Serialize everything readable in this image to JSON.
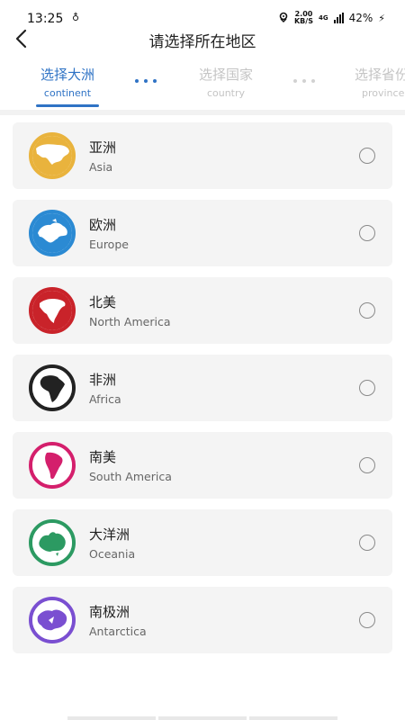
{
  "status": {
    "time": "13:25",
    "extra": "ᵍⁱ",
    "speed_top": "2.00",
    "speed_bottom": "KB/S",
    "network": "4G",
    "battery": "42%"
  },
  "header": {
    "title": "请选择所在地区"
  },
  "tabs": [
    {
      "zh": "选择大洲",
      "en": "continent"
    },
    {
      "zh": "选择国家",
      "en": "country"
    },
    {
      "zh": "选择省份",
      "en": "province"
    }
  ],
  "continents": [
    {
      "zh": "亚洲",
      "en": "Asia",
      "color": "#e9b33d",
      "icon": "asia-map-icon"
    },
    {
      "zh": "欧洲",
      "en": "Europe",
      "color": "#2b8ad3",
      "icon": "europe-map-icon"
    },
    {
      "zh": "北美",
      "en": "North America",
      "color": "#c9232a",
      "icon": "north-america-map-icon"
    },
    {
      "zh": "非洲",
      "en": "Africa",
      "color": "#222222",
      "icon": "africa-map-icon"
    },
    {
      "zh": "南美",
      "en": "South America",
      "color": "#d41f6c",
      "icon": "south-america-map-icon"
    },
    {
      "zh": "大洋洲",
      "en": "Oceania",
      "color": "#2c9a62",
      "icon": "oceania-map-icon"
    },
    {
      "zh": "南极洲",
      "en": "Antarctica",
      "color": "#7a4fd1",
      "icon": "antarctica-map-icon"
    }
  ]
}
